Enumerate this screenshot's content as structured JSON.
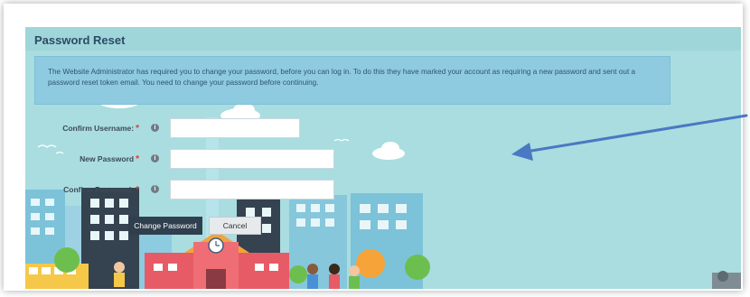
{
  "page": {
    "title": "Password Reset",
    "notice": "The Website Administrator has required you to change your password, before you can log in. To do this they have marked your account as requiring a new password and sent out a password reset token email. You need to change your password before continuing."
  },
  "form": {
    "confirm_username_label": "Confirm Username:",
    "new_password_label": "New Password",
    "confirm_password_label": "Confirm Password:",
    "required_mark": "*",
    "help_glyph": "i",
    "confirm_username_value": "",
    "new_password_value": "",
    "confirm_password_value": ""
  },
  "buttons": {
    "change_password": "Change Password",
    "cancel": "Cancel"
  },
  "colors": {
    "panel_bg": "#a9dde0",
    "notice_bg": "#8fcbe0",
    "title": "#2d4a66",
    "required": "#d43a3a",
    "primary_button": "#2f3f4e",
    "arrow": "#4a78c2"
  },
  "icons": [
    "help-icon",
    "arrow-annotation",
    "sun-icon",
    "cloud-decoration",
    "school-illustration"
  ]
}
